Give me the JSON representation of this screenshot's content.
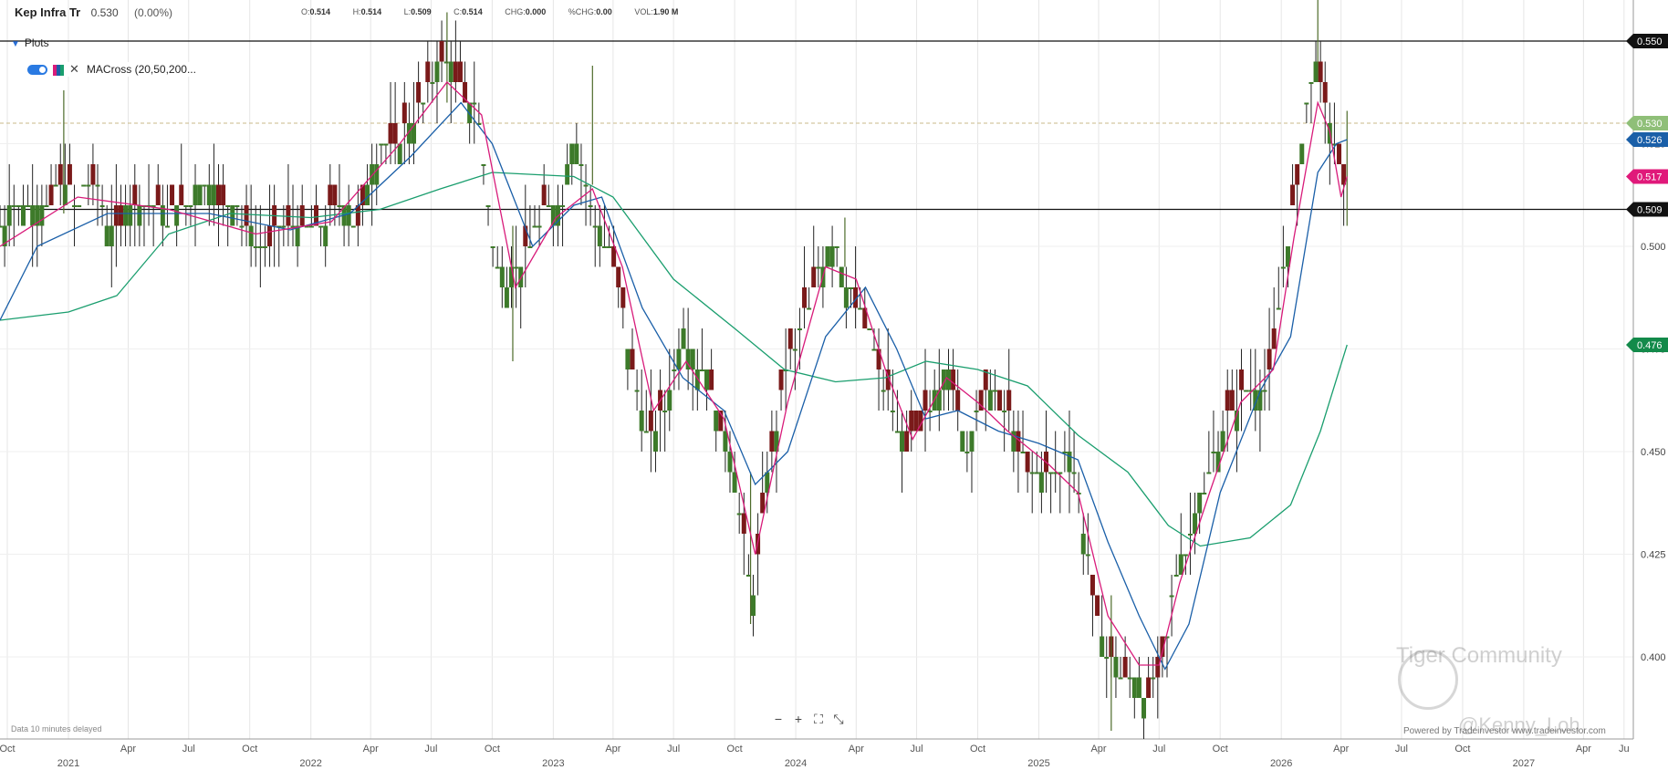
{
  "header": {
    "name": "Kep Infra Tr",
    "price": "0.530",
    "change": "(0.00%)",
    "ohlc": [
      {
        "k": "O:",
        "v": "0.514"
      },
      {
        "k": "H:",
        "v": "0.514"
      },
      {
        "k": "L:",
        "v": "0.509"
      },
      {
        "k": "C:",
        "v": "0.514"
      },
      {
        "k": "CHG:",
        "v": "0.000"
      },
      {
        "k": "%CHG:",
        "v": "0.00"
      },
      {
        "k": "VOL:",
        "v": "1.90 M"
      }
    ]
  },
  "plots_label": "Plots",
  "indicator_label": "MACross (20,50,200...",
  "delayed_note": "Data 10 minutes delayed",
  "powered_by": "Powered by Tradeinvestor www.tradeinvestor.com",
  "watermark": {
    "brand": "Tiger Community",
    "user": "@Kenny_Loh"
  },
  "colors": {
    "up": "#3d7a2a",
    "down": "#7a1a1a",
    "ma20": "#d81b7a",
    "ma50": "#1a5fa8",
    "ma200": "#1a9e6e",
    "hline": "#111111",
    "dashed": "#c9b98a"
  },
  "chart_data": {
    "type": "ohlc",
    "ylim": [
      0.38,
      0.56
    ],
    "yticks": [
      "0.400",
      "0.425",
      "0.450",
      "0.475",
      "0.500",
      "0.525",
      "0.550"
    ],
    "xrange": [
      "2020-09-20",
      "2027-06-15"
    ],
    "month_ticks": [
      {
        "date": "2020-10-01",
        "label": "Oct"
      },
      {
        "date": "2021-04-01",
        "label": "Apr"
      },
      {
        "date": "2021-07-01",
        "label": "Jul"
      },
      {
        "date": "2021-10-01",
        "label": "Oct"
      },
      {
        "date": "2022-04-01",
        "label": "Apr"
      },
      {
        "date": "2022-07-01",
        "label": "Jul"
      },
      {
        "date": "2022-10-01",
        "label": "Oct"
      },
      {
        "date": "2023-04-01",
        "label": "Apr"
      },
      {
        "date": "2023-07-01",
        "label": "Jul"
      },
      {
        "date": "2023-10-01",
        "label": "Oct"
      },
      {
        "date": "2024-04-01",
        "label": "Apr"
      },
      {
        "date": "2024-07-01",
        "label": "Jul"
      },
      {
        "date": "2024-10-01",
        "label": "Oct"
      },
      {
        "date": "2025-04-01",
        "label": "Apr"
      },
      {
        "date": "2025-07-01",
        "label": "Jul"
      },
      {
        "date": "2025-10-01",
        "label": "Oct"
      },
      {
        "date": "2026-04-01",
        "label": "Apr"
      },
      {
        "date": "2026-07-01",
        "label": "Jul"
      },
      {
        "date": "2026-10-01",
        "label": "Oct"
      },
      {
        "date": "2027-04-01",
        "label": "Apr"
      },
      {
        "date": "2027-06-01",
        "label": "Ju"
      }
    ],
    "year_ticks": [
      {
        "date": "2021-01-01",
        "label": "2021"
      },
      {
        "date": "2022-01-01",
        "label": "2022"
      },
      {
        "date": "2023-01-01",
        "label": "2023"
      },
      {
        "date": "2024-01-01",
        "label": "2024"
      },
      {
        "date": "2025-01-01",
        "label": "2025"
      },
      {
        "date": "2026-01-01",
        "label": "2026"
      },
      {
        "date": "2027-01-01",
        "label": "2027"
      }
    ],
    "closes": [
      [
        "2020-09-20",
        0.505
      ],
      [
        "2020-10-15",
        0.512
      ],
      [
        "2020-11-15",
        0.508
      ],
      [
        "2020-12-15",
        0.514
      ],
      [
        "2021-01-15",
        0.512
      ],
      [
        "2021-02-15",
        0.516
      ],
      [
        "2021-03-01",
        0.506
      ],
      [
        "2021-04-01",
        0.508
      ],
      [
        "2021-05-01",
        0.51
      ],
      [
        "2021-06-01",
        0.507
      ],
      [
        "2021-07-01",
        0.512
      ],
      [
        "2021-08-01",
        0.514
      ],
      [
        "2021-09-01",
        0.509
      ],
      [
        "2021-10-01",
        0.506
      ],
      [
        "2021-10-20",
        0.497
      ],
      [
        "2021-11-15",
        0.505
      ],
      [
        "2021-12-15",
        0.507
      ],
      [
        "2022-01-15",
        0.506
      ],
      [
        "2022-02-15",
        0.511
      ],
      [
        "2022-03-15",
        0.505
      ],
      [
        "2022-04-01",
        0.52
      ],
      [
        "2022-05-01",
        0.525
      ],
      [
        "2022-06-01",
        0.53
      ],
      [
        "2022-07-01",
        0.54
      ],
      [
        "2022-07-20",
        0.548
      ],
      [
        "2022-08-15",
        0.538
      ],
      [
        "2022-09-10",
        0.532
      ],
      [
        "2022-10-01",
        0.502
      ],
      [
        "2022-10-20",
        0.49
      ],
      [
        "2022-11-15",
        0.497
      ],
      [
        "2022-12-15",
        0.508
      ],
      [
        "2023-01-15",
        0.512
      ],
      [
        "2023-02-01",
        0.53
      ],
      [
        "2023-02-20",
        0.514
      ],
      [
        "2023-03-15",
        0.502
      ],
      [
        "2023-04-01",
        0.498
      ],
      [
        "2023-05-01",
        0.47
      ],
      [
        "2023-05-20",
        0.455
      ],
      [
        "2023-06-15",
        0.458
      ],
      [
        "2023-07-15",
        0.478
      ],
      [
        "2023-08-15",
        0.47
      ],
      [
        "2023-09-15",
        0.455
      ],
      [
        "2023-10-15",
        0.432
      ],
      [
        "2023-10-25",
        0.412
      ],
      [
        "2023-11-15",
        0.44
      ],
      [
        "2023-12-15",
        0.468
      ],
      [
        "2024-01-15",
        0.485
      ],
      [
        "2024-02-15",
        0.497
      ],
      [
        "2024-03-01",
        0.502
      ],
      [
        "2024-03-20",
        0.49
      ],
      [
        "2024-04-15",
        0.482
      ],
      [
        "2024-05-15",
        0.465
      ],
      [
        "2024-06-15",
        0.45
      ],
      [
        "2024-07-15",
        0.46
      ],
      [
        "2024-08-15",
        0.47
      ],
      [
        "2024-09-15",
        0.452
      ],
      [
        "2024-10-15",
        0.465
      ],
      [
        "2024-11-15",
        0.46
      ],
      [
        "2024-12-15",
        0.445
      ],
      [
        "2025-01-15",
        0.444
      ],
      [
        "2025-02-15",
        0.45
      ],
      [
        "2025-03-01",
        0.44
      ],
      [
        "2025-03-20",
        0.42
      ],
      [
        "2025-04-10",
        0.402
      ],
      [
        "2025-05-10",
        0.395
      ],
      [
        "2025-06-10",
        0.392
      ],
      [
        "2025-07-01",
        0.393
      ],
      [
        "2025-07-20",
        0.415
      ],
      [
        "2025-08-15",
        0.43
      ],
      [
        "2025-09-15",
        0.445
      ],
      [
        "2025-10-15",
        0.46
      ],
      [
        "2025-11-15",
        0.465
      ],
      [
        "2025-12-15",
        0.468
      ],
      [
        "2026-01-10",
        0.5
      ],
      [
        "2026-02-01",
        0.525
      ],
      [
        "2026-02-20",
        0.548
      ],
      [
        "2026-03-10",
        0.535
      ],
      [
        "2026-04-01",
        0.515
      ],
      [
        "2026-04-10",
        0.514
      ]
    ],
    "highlight_bars": [
      {
        "date": "2020-12-25",
        "high": 0.538,
        "low": 0.508
      },
      {
        "date": "2022-07-25",
        "high": 0.557,
        "low": 0.535
      },
      {
        "date": "2023-03-01",
        "high": 0.544,
        "low": 0.515
      },
      {
        "date": "2022-11-01",
        "high": 0.505,
        "low": 0.472
      },
      {
        "date": "2023-10-25",
        "high": 0.445,
        "low": 0.408
      },
      {
        "date": "2024-03-15",
        "high": 0.507,
        "low": 0.495
      },
      {
        "date": "2025-04-20",
        "high": 0.415,
        "low": 0.382
      },
      {
        "date": "2026-02-25",
        "high": 0.566,
        "low": 0.54
      },
      {
        "date": "2026-04-10",
        "high": 0.533,
        "low": 0.505
      }
    ],
    "hlines": [
      0.55,
      0.509
    ],
    "dashed_line": 0.53,
    "ma20": [
      [
        "2020-09-20",
        0.5
      ],
      [
        "2021-01-15",
        0.512
      ],
      [
        "2021-06-01",
        0.509
      ],
      [
        "2021-10-10",
        0.503
      ],
      [
        "2022-02-01",
        0.506
      ],
      [
        "2022-05-15",
        0.525
      ],
      [
        "2022-07-25",
        0.54
      ],
      [
        "2022-09-15",
        0.532
      ],
      [
        "2022-11-05",
        0.49
      ],
      [
        "2023-01-05",
        0.507
      ],
      [
        "2023-03-01",
        0.514
      ],
      [
        "2023-04-15",
        0.495
      ],
      [
        "2023-06-01",
        0.46
      ],
      [
        "2023-07-20",
        0.472
      ],
      [
        "2023-09-15",
        0.458
      ],
      [
        "2023-11-01",
        0.425
      ],
      [
        "2023-12-20",
        0.462
      ],
      [
        "2024-02-15",
        0.495
      ],
      [
        "2024-04-01",
        0.492
      ],
      [
        "2024-05-15",
        0.47
      ],
      [
        "2024-06-25",
        0.453
      ],
      [
        "2024-08-15",
        0.468
      ],
      [
        "2024-10-01",
        0.462
      ],
      [
        "2024-11-15",
        0.455
      ],
      [
        "2025-01-15",
        0.447
      ],
      [
        "2025-03-01",
        0.44
      ],
      [
        "2025-04-15",
        0.41
      ],
      [
        "2025-06-01",
        0.398
      ],
      [
        "2025-07-01",
        0.398
      ],
      [
        "2025-08-01",
        0.418
      ],
      [
        "2025-09-15",
        0.44
      ],
      [
        "2025-11-01",
        0.462
      ],
      [
        "2025-12-20",
        0.47
      ],
      [
        "2026-01-20",
        0.502
      ],
      [
        "2026-02-25",
        0.535
      ],
      [
        "2026-03-15",
        0.528
      ],
      [
        "2026-04-01",
        0.512
      ],
      [
        "2026-04-10",
        0.517
      ]
    ],
    "ma50": [
      [
        "2020-09-20",
        0.482
      ],
      [
        "2020-11-15",
        0.5
      ],
      [
        "2021-03-01",
        0.508
      ],
      [
        "2021-08-01",
        0.508
      ],
      [
        "2021-12-01",
        0.504
      ],
      [
        "2022-03-01",
        0.508
      ],
      [
        "2022-06-01",
        0.522
      ],
      [
        "2022-08-15",
        0.535
      ],
      [
        "2022-10-01",
        0.525
      ],
      [
        "2022-12-01",
        0.5
      ],
      [
        "2023-02-01",
        0.51
      ],
      [
        "2023-03-15",
        0.512
      ],
      [
        "2023-05-15",
        0.485
      ],
      [
        "2023-07-15",
        0.468
      ],
      [
        "2023-09-15",
        0.46
      ],
      [
        "2023-11-01",
        0.442
      ],
      [
        "2023-12-20",
        0.45
      ],
      [
        "2024-02-15",
        0.478
      ],
      [
        "2024-04-15",
        0.49
      ],
      [
        "2024-06-01",
        0.475
      ],
      [
        "2024-07-15",
        0.458
      ],
      [
        "2024-09-01",
        0.46
      ],
      [
        "2024-11-01",
        0.455
      ],
      [
        "2025-01-01",
        0.452
      ],
      [
        "2025-03-01",
        0.448
      ],
      [
        "2025-04-15",
        0.428
      ],
      [
        "2025-06-01",
        0.41
      ],
      [
        "2025-07-10",
        0.397
      ],
      [
        "2025-08-15",
        0.408
      ],
      [
        "2025-10-01",
        0.44
      ],
      [
        "2025-12-01",
        0.465
      ],
      [
        "2026-01-15",
        0.478
      ],
      [
        "2026-02-25",
        0.518
      ],
      [
        "2026-03-25",
        0.525
      ],
      [
        "2026-04-10",
        0.526
      ]
    ],
    "ma200": [
      [
        "2020-09-20",
        0.482
      ],
      [
        "2021-01-01",
        0.484
      ],
      [
        "2021-03-15",
        0.488
      ],
      [
        "2021-06-01",
        0.503
      ],
      [
        "2021-09-01",
        0.508
      ],
      [
        "2022-01-01",
        0.507
      ],
      [
        "2022-04-15",
        0.509
      ],
      [
        "2022-07-15",
        0.514
      ],
      [
        "2022-10-01",
        0.518
      ],
      [
        "2023-02-01",
        0.517
      ],
      [
        "2023-04-01",
        0.512
      ],
      [
        "2023-07-01",
        0.492
      ],
      [
        "2023-10-01",
        0.48
      ],
      [
        "2023-12-15",
        0.47
      ],
      [
        "2024-03-01",
        0.467
      ],
      [
        "2024-05-15",
        0.468
      ],
      [
        "2024-07-15",
        0.472
      ],
      [
        "2024-10-01",
        0.47
      ],
      [
        "2024-12-15",
        0.466
      ],
      [
        "2025-03-01",
        0.454
      ],
      [
        "2025-05-15",
        0.445
      ],
      [
        "2025-07-15",
        0.432
      ],
      [
        "2025-09-01",
        0.427
      ],
      [
        "2025-11-15",
        0.429
      ],
      [
        "2026-01-15",
        0.437
      ],
      [
        "2026-03-01",
        0.455
      ],
      [
        "2026-04-10",
        0.476
      ]
    ],
    "price_labels": [
      {
        "value": 0.55,
        "text": "0.550",
        "color": "#111111"
      },
      {
        "value": 0.53,
        "text": "0.530",
        "color": "#8fbf78"
      },
      {
        "value": 0.526,
        "text": "0.526",
        "color": "#1a5fa8"
      },
      {
        "value": 0.517,
        "text": "0.517",
        "color": "#e0197a"
      },
      {
        "value": 0.509,
        "text": "0.509",
        "color": "#111111"
      },
      {
        "value": 0.476,
        "text": "0.476",
        "color": "#138a4a"
      }
    ]
  }
}
